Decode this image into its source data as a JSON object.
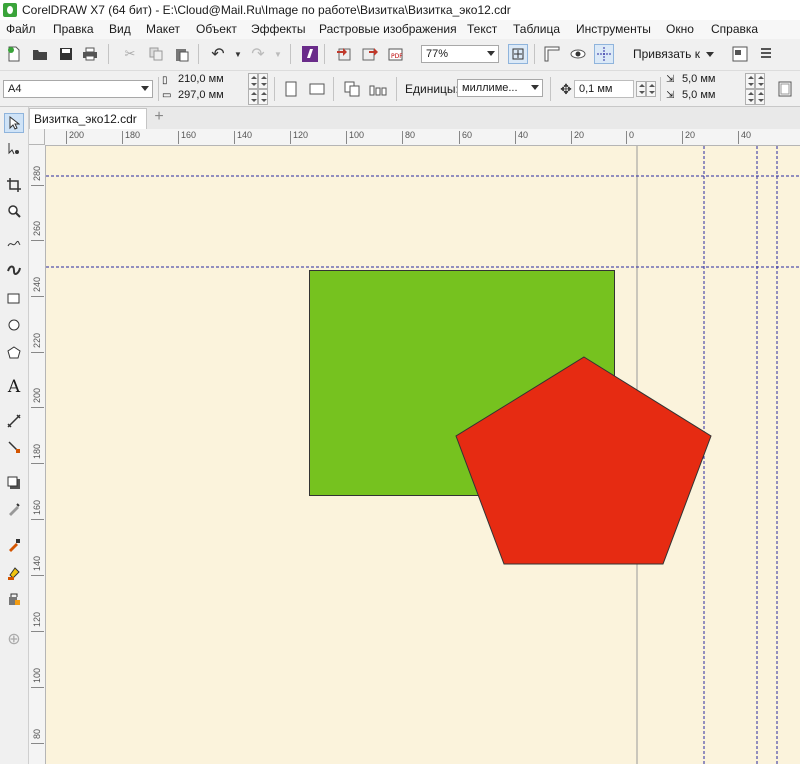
{
  "window": {
    "title": "CorelDRAW X7 (64 бит) - E:\\Cloud@Mail.Ru\\Image по работе\\Визитка\\Визитка_эко12.cdr"
  },
  "menu": [
    "Файл",
    "Правка",
    "Вид",
    "Макет",
    "Объект",
    "Эффекты",
    "Растровые изображения",
    "Текст",
    "Таблица",
    "Инструменты",
    "Окно",
    "Справка"
  ],
  "toolbar": {
    "zoom": "77%",
    "snap_label": "Привязать к"
  },
  "properties": {
    "page_size": "A4",
    "width": "210,0 мм",
    "height": "297,0 мм",
    "units_label": "Единицы:",
    "units_value": "миллиме...",
    "nudge": "0,1 мм",
    "dup_x": "5,0 мм",
    "dup_y": "5,0 мм"
  },
  "document_tab": "Визитка_эко12.cdr",
  "ruler": {
    "horizontal": [
      "200",
      "180",
      "160",
      "140",
      "120",
      "100",
      "80",
      "60",
      "40",
      "20",
      "0",
      "20",
      "40"
    ],
    "vertical": [
      "280",
      "260",
      "240",
      "220",
      "200",
      "180",
      "160",
      "140",
      "120",
      "100",
      "80"
    ]
  },
  "shapes": {
    "rectangle": {
      "fill": "#76c21f"
    },
    "pentagon": {
      "fill": "#e62b12"
    }
  },
  "colors": {
    "canvas": "#fbf3dc",
    "guide": "#2a2aa0"
  }
}
